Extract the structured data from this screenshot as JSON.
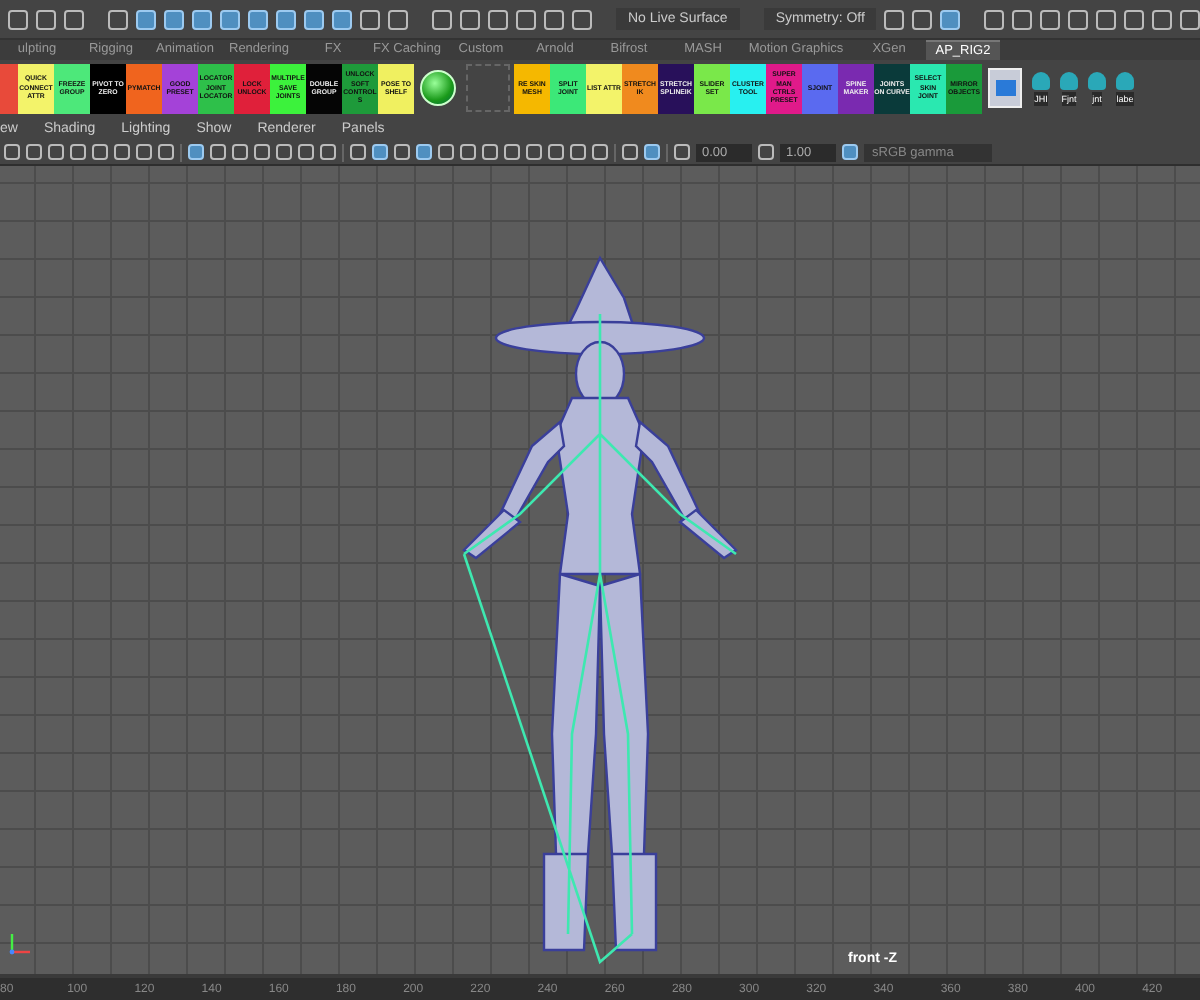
{
  "status_bar": {
    "live_surface": "No Live Surface",
    "symmetry": "Symmetry: Off"
  },
  "shelf_tabs": [
    {
      "label": "ulpting",
      "selected": false
    },
    {
      "label": "Rigging",
      "selected": false
    },
    {
      "label": "Animation",
      "selected": false
    },
    {
      "label": "Rendering",
      "selected": false
    },
    {
      "label": "FX",
      "selected": false
    },
    {
      "label": "FX Caching",
      "selected": false
    },
    {
      "label": "Custom",
      "selected": false
    },
    {
      "label": "Arnold",
      "selected": false
    },
    {
      "label": "Bifrost",
      "selected": false
    },
    {
      "label": "MASH",
      "selected": false
    },
    {
      "label": "Motion Graphics",
      "selected": false
    },
    {
      "label": "XGen",
      "selected": false
    },
    {
      "label": "AP_RIG2",
      "selected": true
    }
  ],
  "shelf_buttons": [
    {
      "kind": "stub",
      "color": "#e84a3a"
    },
    {
      "kind": "button",
      "label": "QUICK CONNECT ATTR",
      "color": "#f3f36a"
    },
    {
      "kind": "button",
      "label": "FREEZE GROUP",
      "color": "#4de87a"
    },
    {
      "kind": "button",
      "label": "PIVOT TO ZERO",
      "color": "#000000"
    },
    {
      "kind": "button",
      "label": "PYMATCH",
      "color": "#f0641e"
    },
    {
      "kind": "button",
      "label": "GOOD PRESET",
      "color": "#a442d8"
    },
    {
      "kind": "button",
      "label": "LOCATOR JOINT LOCATOR",
      "color": "#2ec04a"
    },
    {
      "kind": "button",
      "label": "LOCK UNLOCK",
      "color": "#e0203a"
    },
    {
      "kind": "button",
      "label": "MULTIPLE SAVE JOINTS",
      "color": "#3cf23c"
    },
    {
      "kind": "button",
      "label": "DOUBLE GROUP",
      "color": "#050505"
    },
    {
      "kind": "button",
      "label": "UNLOCK SOFT CONTROLS",
      "color": "#1e9a3a"
    },
    {
      "kind": "button",
      "label": "POSE TO SHELF",
      "color": "#f0f060"
    },
    {
      "kind": "ball"
    },
    {
      "kind": "empty"
    },
    {
      "kind": "button",
      "label": "RE SKIN MESH",
      "color": "#f5b800"
    },
    {
      "kind": "button",
      "label": "SPLIT JOINT",
      "color": "#3ce878"
    },
    {
      "kind": "button",
      "label": "LIST ATTR",
      "color": "#f3f36a"
    },
    {
      "kind": "button",
      "label": "STRETCH IK",
      "color": "#f08a1e"
    },
    {
      "kind": "button",
      "label": "STRETCH SPLINEIK",
      "color": "#28105a"
    },
    {
      "kind": "button",
      "label": "SLIDER SET",
      "color": "#7ae84a"
    },
    {
      "kind": "button",
      "label": "CLUSTER TOOL",
      "color": "#28f0f0"
    },
    {
      "kind": "button",
      "label": "SUPER MAN CTRLS PRESET",
      "color": "#e01a8a"
    },
    {
      "kind": "button",
      "label": "SJOINT",
      "color": "#5a6af0"
    },
    {
      "kind": "button",
      "label": "SPINE MAKER",
      "color": "#7a2ab0"
    },
    {
      "kind": "button",
      "label": "JOINTS ON CURVE",
      "color": "#0a3a3a"
    },
    {
      "kind": "button",
      "label": "SELECT SKIN JOINT",
      "color": "#2ae8b0"
    },
    {
      "kind": "button",
      "label": "MIRROR OBJECTS",
      "color": "#1a9a3a"
    },
    {
      "kind": "image"
    },
    {
      "kind": "joint",
      "label": "JHI"
    },
    {
      "kind": "joint",
      "label": "Fjnt"
    },
    {
      "kind": "joint",
      "label": "jnt"
    },
    {
      "kind": "joint",
      "label": "labe"
    }
  ],
  "panel_menu": [
    "ew",
    "Shading",
    "Lighting",
    "Show",
    "Renderer",
    "Panels"
  ],
  "panel_toolbar": {
    "exposure": "0.00",
    "gamma": "1.00",
    "color_space": "sRGB gamma"
  },
  "viewport": {
    "camera_label": "front -Z"
  },
  "time_ruler": [
    "80",
    "100",
    "120",
    "140",
    "160",
    "180",
    "200",
    "220",
    "240",
    "260",
    "280",
    "300",
    "320",
    "340",
    "360",
    "380",
    "400",
    "420"
  ]
}
